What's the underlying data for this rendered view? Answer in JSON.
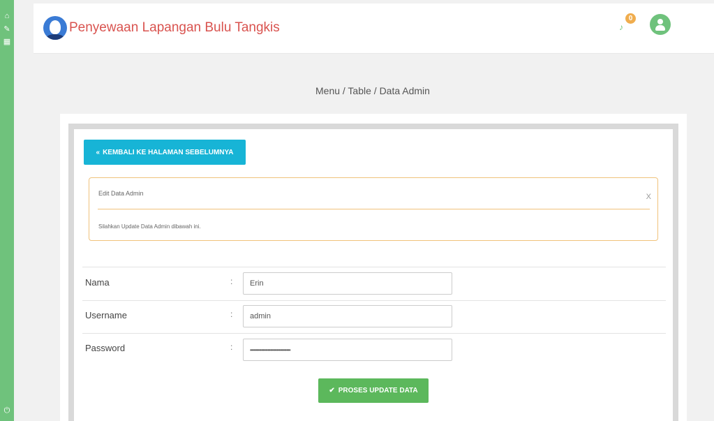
{
  "sidebar": {
    "items": [
      {
        "icon": "home-icon",
        "glyph": "⌂"
      },
      {
        "icon": "edit-icon",
        "glyph": "✎"
      },
      {
        "icon": "calendar-icon",
        "glyph": "▦"
      }
    ],
    "power_glyph": "⏻"
  },
  "header": {
    "title": "Penyewaan Lapangan Bulu Tangkis",
    "notification_count": "0",
    "bell_glyph": "♪"
  },
  "breadcrumb": "Menu / Table / Data Admin",
  "back_button": {
    "icon_glyph": "«",
    "label": "KEMBALI KE HALAMAN SEBELUMNYA"
  },
  "alert": {
    "title": "Edit Data Admin",
    "close_label": "X",
    "message": "Silahkan Update Data Admin dibawah ini."
  },
  "form": {
    "separator": ":",
    "fields": [
      {
        "label": "Nama",
        "value": "Erin"
      },
      {
        "label": "Username",
        "value": "admin"
      },
      {
        "label": "Password",
        "value": "••••••••••••••••••••••••••••••••"
      }
    ]
  },
  "submit_button": {
    "icon_glyph": "✔",
    "label": "PROSES UPDATE DATA"
  },
  "colors": {
    "sidebar": "#6fc27c",
    "title": "#d9534f",
    "back_button": "#17b4d6",
    "submit_button": "#5cb85c",
    "alert_border": "#f0c27b",
    "badge": "#f0ad4e"
  }
}
